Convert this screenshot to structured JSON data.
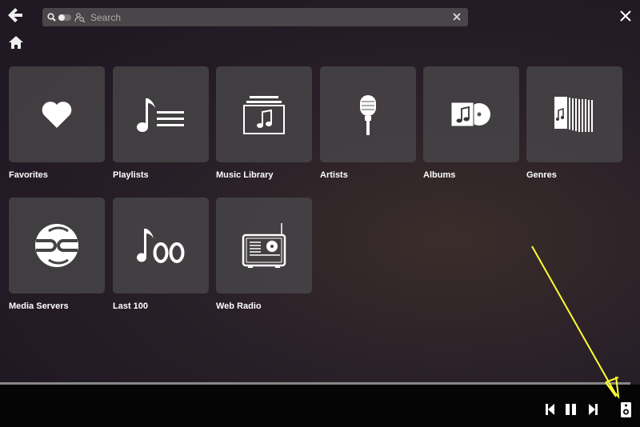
{
  "search": {
    "placeholder": "Search"
  },
  "tiles": [
    {
      "label": "Favorites",
      "icon": "heart-icon"
    },
    {
      "label": "Playlists",
      "icon": "playlist-icon"
    },
    {
      "label": "Music Library",
      "icon": "music-library-icon"
    },
    {
      "label": "Artists",
      "icon": "microphone-icon"
    },
    {
      "label": "Albums",
      "icon": "album-icon"
    },
    {
      "label": "Genres",
      "icon": "genres-icon"
    },
    {
      "label": "Media Servers",
      "icon": "media-server-icon"
    },
    {
      "label": "Last 100",
      "icon": "last-100-icon"
    },
    {
      "label": "Web Radio",
      "icon": "radio-icon"
    }
  ],
  "colors": {
    "annotation": "#ffff33",
    "background": "#1f1822",
    "tile": "#464446"
  }
}
